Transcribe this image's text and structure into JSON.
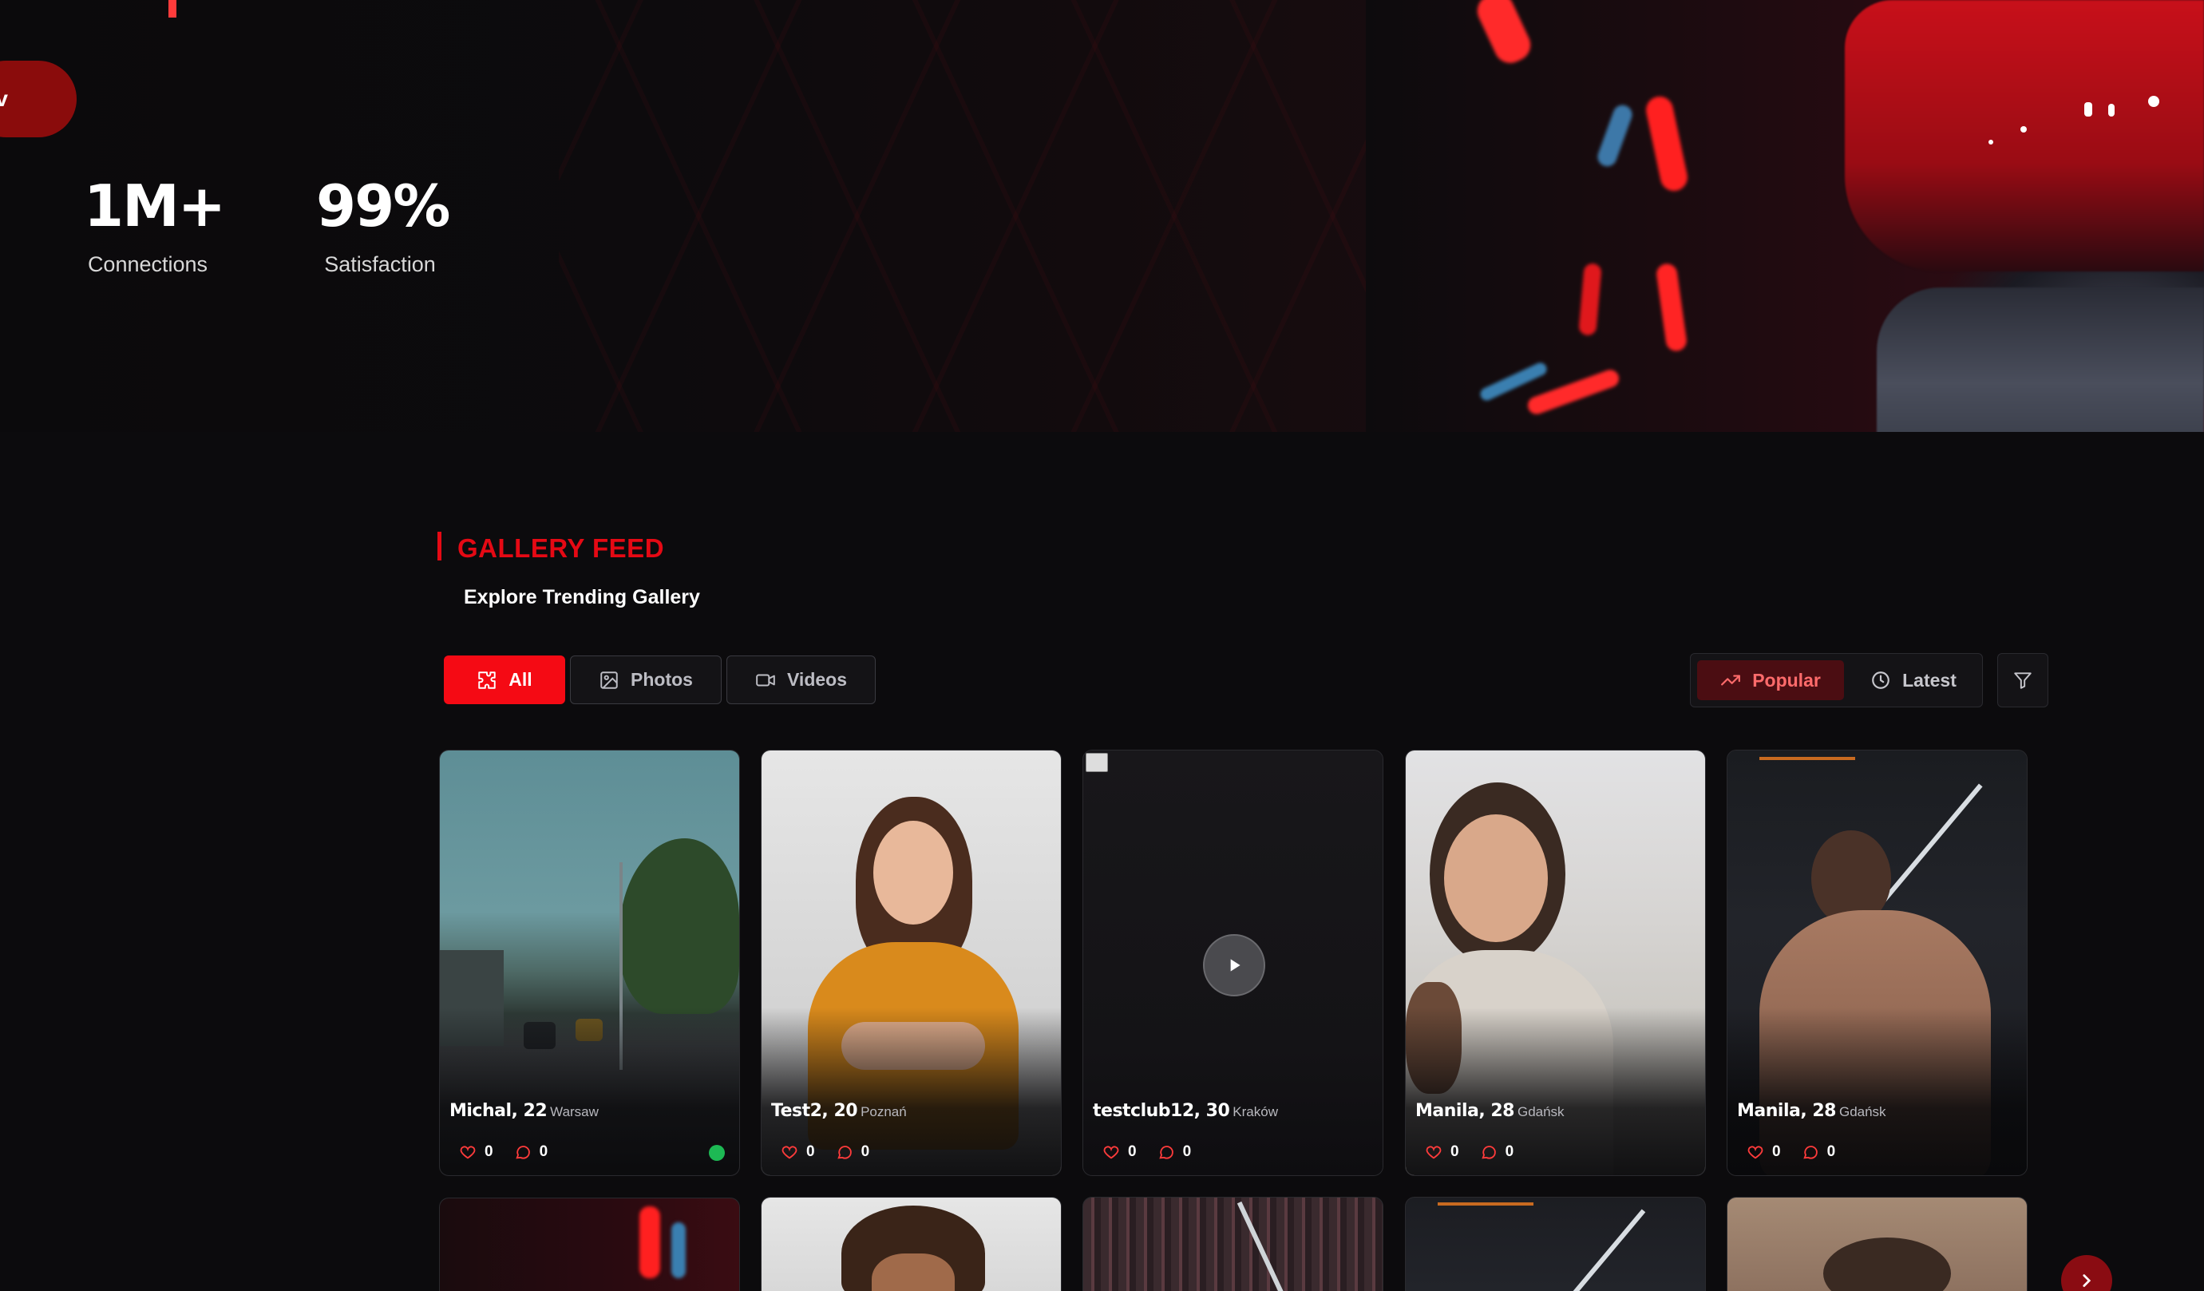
{
  "hero": {
    "cta_label": "v",
    "stats": [
      {
        "value": "1M+",
        "label": "Connections"
      },
      {
        "value": "99%",
        "label": "Satisfaction"
      }
    ]
  },
  "gallery": {
    "title": "GALLERY FEED",
    "subtitle": "Explore Trending Gallery",
    "filters": [
      {
        "label": "All",
        "icon": "puzzle-icon",
        "active": true
      },
      {
        "label": "Photos",
        "icon": "image-icon",
        "active": false
      },
      {
        "label": "Videos",
        "icon": "video-icon",
        "active": false
      }
    ],
    "sort": [
      {
        "label": "Popular",
        "icon": "trending-up-icon",
        "active": true
      },
      {
        "label": "Latest",
        "icon": "clock-icon",
        "active": false
      }
    ],
    "filter_icon": "funnel-icon",
    "cards": [
      {
        "name": "Michal, 22",
        "city": "Warsaw",
        "likes": "0",
        "comments": "0",
        "online": true,
        "type": "photo"
      },
      {
        "name": "Test2, 20",
        "city": "Poznań",
        "likes": "0",
        "comments": "0",
        "online": false,
        "type": "photo"
      },
      {
        "name": "testclub12, 30",
        "city": "Kraków",
        "likes": "0",
        "comments": "0",
        "online": false,
        "type": "video"
      },
      {
        "name": "Manila, 28",
        "city": "Gdańsk",
        "likes": "0",
        "comments": "0",
        "online": false,
        "type": "photo"
      },
      {
        "name": "Manila, 28",
        "city": "Gdańsk",
        "likes": "0",
        "comments": "0",
        "online": false,
        "type": "photo"
      }
    ],
    "next_icon": "chevron-right-icon"
  },
  "colors": {
    "accent": "#e50914",
    "online": "#1db954",
    "background": "#0c0b0d"
  }
}
